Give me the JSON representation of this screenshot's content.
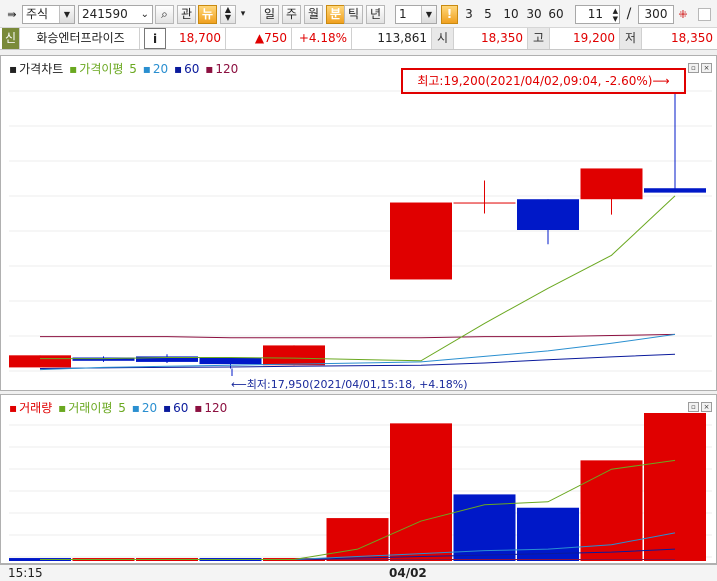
{
  "toolbar": {
    "market_select": "주식",
    "code_input": "241590",
    "btn_watch": "관",
    "btn_news": "뉴",
    "period_day": "일",
    "period_week": "주",
    "period_month": "월",
    "period_minute": "분",
    "period_tick": "틱",
    "period_year": "년",
    "interval_select": "1",
    "interval_options": [
      "3",
      "5",
      "10",
      "30",
      "60"
    ],
    "count_value": "11",
    "separator": "/",
    "total_value": "300"
  },
  "stock": {
    "badge": "신",
    "name": "화승엔터프라이즈",
    "info_button": "i",
    "price": "18,700",
    "change": "▲750",
    "change_rate": "+4.18%",
    "volume": "113,861",
    "open_label": "시",
    "open": "18,350",
    "high_label": "고",
    "high": "19,200",
    "low_label": "저",
    "low": "18,350"
  },
  "price_chart": {
    "title": "가격차트",
    "ma_label": "가격이평",
    "ma_periods": [
      "5",
      "20",
      "60",
      "120"
    ],
    "high_annotation": "최고:19,200(2021/04/02,09:04, -2.60%)⟶",
    "low_annotation": "⟵최저:17,950(2021/04/01,15:18, +4.18%)"
  },
  "volume_chart": {
    "title": "거래량",
    "ma_label": "거래이평",
    "ma_periods": [
      "5",
      "20",
      "60",
      "120"
    ]
  },
  "time_axis": {
    "left_label": "15:15",
    "date_label": "04/02"
  },
  "colors": {
    "up": "#e00000",
    "down": "#0018c8",
    "ma5": "#6aa820",
    "ma20": "#2a8fd0",
    "ma60": "#0a1a9c",
    "ma120": "#8c1040"
  },
  "chart_data": [
    {
      "type": "candlestick",
      "title": "가격차트",
      "series": [
        {
          "open": 17950,
          "close": 18005,
          "high": 18005,
          "low": 17950
        },
        {
          "open": 17995,
          "close": 17980,
          "high": 18000,
          "low": 17975
        },
        {
          "open": 18000,
          "close": 17975,
          "high": 18010,
          "low": 17970
        },
        {
          "open": 17995,
          "close": 17965,
          "high": 17995,
          "low": 17945
        },
        {
          "open": 17960,
          "close": 18050,
          "high": 18050,
          "low": 17960
        },
        {
          "open": 18350,
          "close": 18700,
          "high": 18700,
          "low": 18350
        },
        {
          "open": 18700,
          "close": 18700,
          "high": 18800,
          "low": 18650
        },
        {
          "open": 18715,
          "close": 18575,
          "high": 18715,
          "low": 18510
        },
        {
          "open": 18715,
          "close": 18855,
          "high": 18855,
          "low": 18645
        },
        {
          "open": 18765,
          "close": 18745,
          "high": 19200,
          "low": 18745
        }
      ],
      "ma5": [
        17990,
        17990,
        17995,
        17995,
        17992,
        17980,
        18150,
        18310,
        18460,
        18730
      ],
      "ma20": [
        17940,
        17950,
        17955,
        17960,
        17965,
        17975,
        18000,
        18025,
        18060,
        18100
      ],
      "ma60": [
        17945,
        17948,
        17950,
        17952,
        17955,
        17960,
        17970,
        17985,
        17998,
        18010
      ],
      "ma120": [
        18090,
        18090,
        18090,
        18085,
        18085,
        18085,
        18090,
        18090,
        18095,
        18100
      ],
      "ylim": [
        17920,
        19230
      ]
    },
    {
      "type": "bar",
      "title": "거래량",
      "values": [
        2,
        2,
        2,
        2,
        2,
        29,
        93,
        45,
        36,
        68,
        100
      ],
      "colors": [
        "down",
        "up",
        "up",
        "down",
        "up",
        "up",
        "up",
        "down",
        "down",
        "up",
        "up"
      ],
      "ma5": [
        1,
        1,
        1,
        1,
        1,
        8,
        27,
        38,
        40,
        62,
        68
      ],
      "ma20": [
        1,
        1,
        1,
        1,
        1,
        3,
        5,
        7,
        8,
        11,
        19
      ],
      "ma60": [
        1,
        1,
        1,
        1,
        1,
        2,
        3,
        4,
        5,
        6,
        8
      ],
      "ma120": [
        1,
        1,
        1,
        1,
        1,
        1,
        1,
        1,
        1,
        1,
        1
      ],
      "ylim": [
        0,
        100
      ]
    }
  ]
}
